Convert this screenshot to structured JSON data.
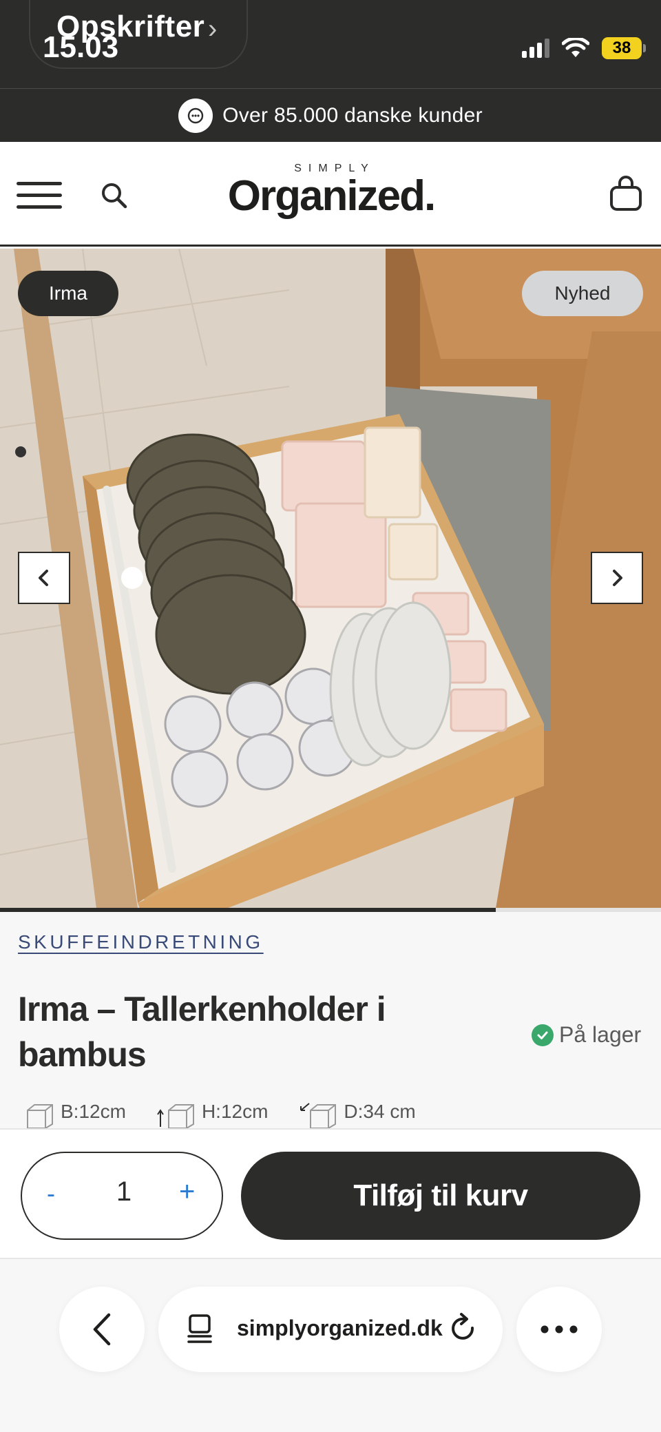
{
  "status_bar": {
    "back_app_label": "Opskrifter",
    "time": "15.03",
    "battery": "38"
  },
  "promo": {
    "text": "Over 85.000 danske kunder"
  },
  "header": {
    "logo_small": "SIMPLY",
    "logo_big": "Organized."
  },
  "hero": {
    "badge_left": "Irma",
    "badge_right": "Nyhed",
    "slider_progress": 0.75
  },
  "product": {
    "category": "SKUFFEINDRETNING",
    "title": "Irma – Tallerkenholder i bambus",
    "stock": "På lager",
    "dimensions": {
      "width": "B:12cm",
      "height": "H:12cm",
      "depth": "D:34 cm"
    }
  },
  "cart": {
    "minus": "-",
    "quantity": "1",
    "plus": "+",
    "add_label": "Tilføj til kurv"
  },
  "browser": {
    "url": "simplyorganized.dk"
  },
  "colors": {
    "dark": "#2c2d2b",
    "link": "#3a4a78",
    "accent_blue": "#2a7bd1",
    "stock_green": "#3aa86b",
    "battery_yellow": "#f2d21f"
  }
}
